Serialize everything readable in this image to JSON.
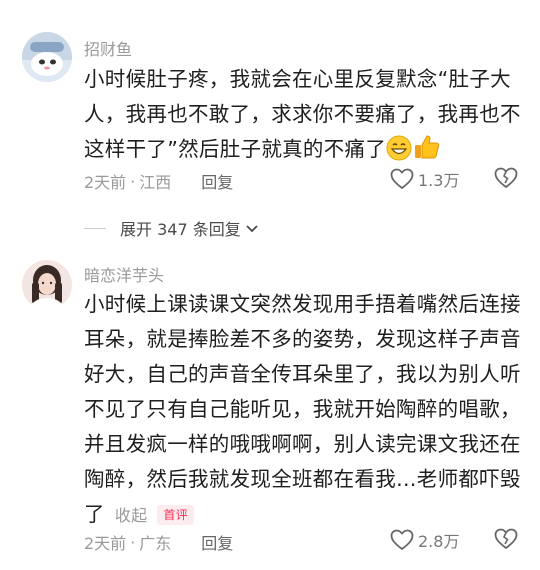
{
  "comments": [
    {
      "username": "招财鱼",
      "text": "小时候肚子疼，我就会在心里反复默念“肚子大人，我再也不敢了，求求你不要痛了，我再也不这样干了”然后肚子就真的不痛了",
      "time": "2天前",
      "location": "江西",
      "reply_label": "回复",
      "like_count": "1.3万",
      "emojis": [
        "grin-emoji",
        "thumbs-up-emoji"
      ]
    },
    {
      "username": "暗恋洋芋头",
      "text": "小时候上课读课文突然发现用手捂着嘴然后连接耳朵，就是捧脸差不多的姿势，发现这样子声音好大，自己的声音全传耳朵里了，我以为别人听不见了只有自己能听见，我就开始陶醉的唱歌，并且发疯一样的哦哦啊啊，别人读完课文我还在陶醉，然后我就发现全班都在看我…老师都吓毁了",
      "collapse_label": "收起",
      "badge": "首评",
      "time": "2天前",
      "location": "广东",
      "reply_label": "回复",
      "like_count": "2.8万"
    }
  ],
  "expand_replies": "展开 347 条回复",
  "separator": "·",
  "colors": {
    "badge_red": "#fe2c55",
    "muted": "#9a9a9a"
  }
}
